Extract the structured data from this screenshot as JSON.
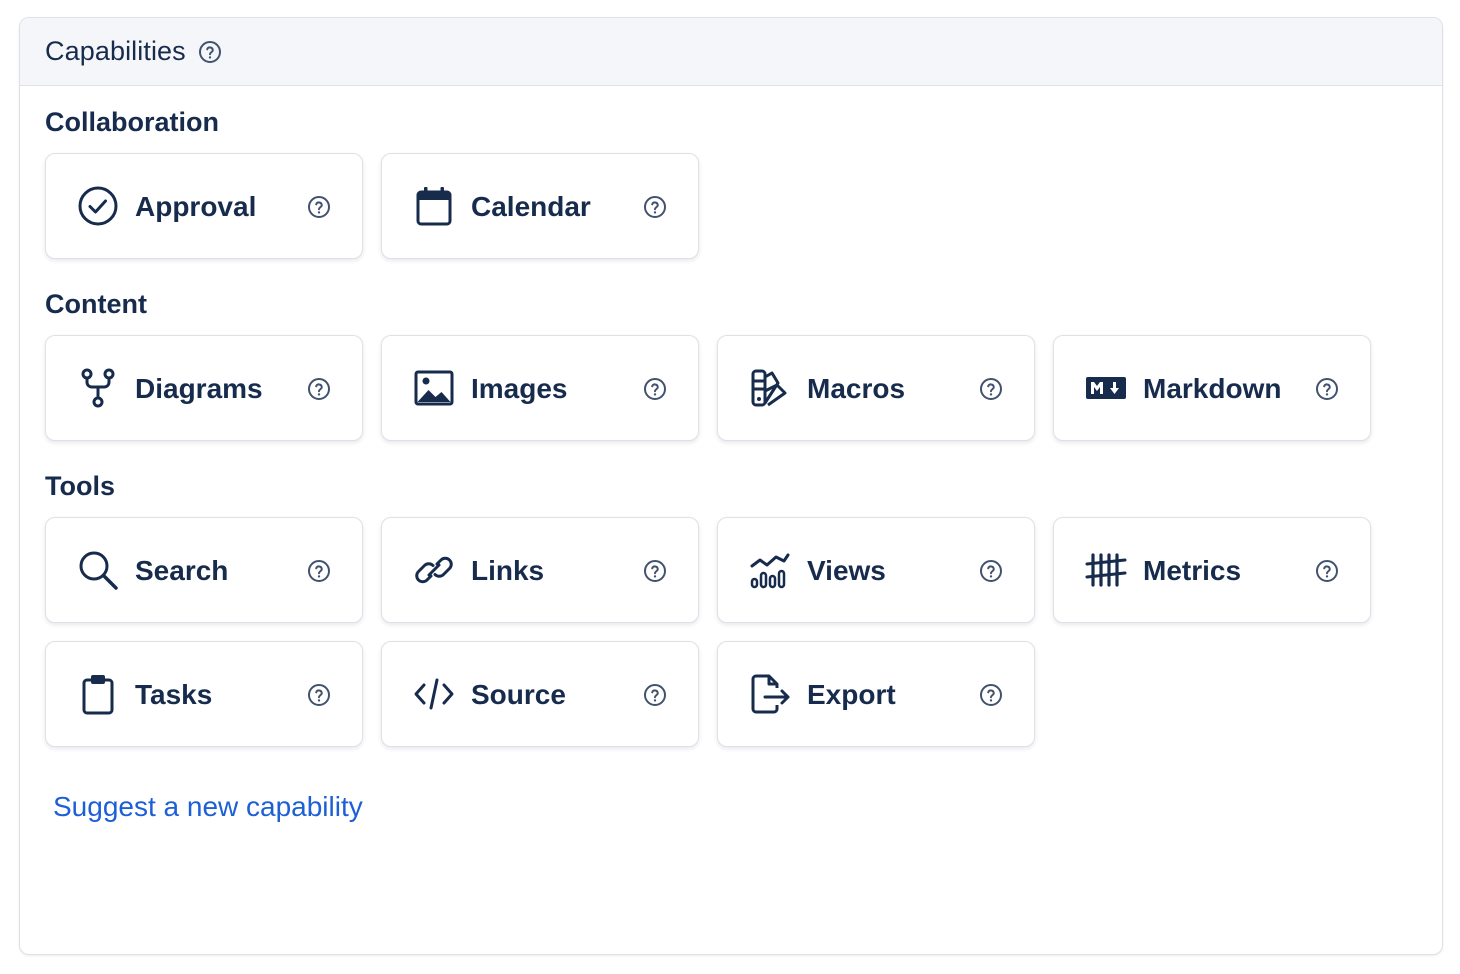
{
  "panel": {
    "title": "Capabilities"
  },
  "sections": [
    {
      "title": "Collaboration"
    },
    {
      "title": "Content"
    },
    {
      "title": "Tools"
    }
  ],
  "cards": {
    "approval": {
      "label": "Approval",
      "icon": "check-circle-icon"
    },
    "calendar": {
      "label": "Calendar",
      "icon": "calendar-icon"
    },
    "diagrams": {
      "label": "Diagrams",
      "icon": "fork-icon"
    },
    "images": {
      "label": "Images",
      "icon": "image-icon"
    },
    "macros": {
      "label": "Macros",
      "icon": "swatch-icon"
    },
    "markdown": {
      "label": "Markdown",
      "icon": "markdown-icon"
    },
    "search": {
      "label": "Search",
      "icon": "search-icon"
    },
    "links": {
      "label": "Links",
      "icon": "link-icon"
    },
    "views": {
      "label": "Views",
      "icon": "chart-icon"
    },
    "metrics": {
      "label": "Metrics",
      "icon": "tally-icon"
    },
    "tasks": {
      "label": "Tasks",
      "icon": "clipboard-icon"
    },
    "source": {
      "label": "Source",
      "icon": "code-icon"
    },
    "export": {
      "label": "Export",
      "icon": "export-icon"
    }
  },
  "footer": {
    "suggest_link": "Suggest a new capability"
  },
  "colors": {
    "text": "#172b4d",
    "link": "#1d5fd6",
    "border": "#dfe1e6",
    "header_bg": "#f4f6f9",
    "help_icon": "#42526e"
  }
}
